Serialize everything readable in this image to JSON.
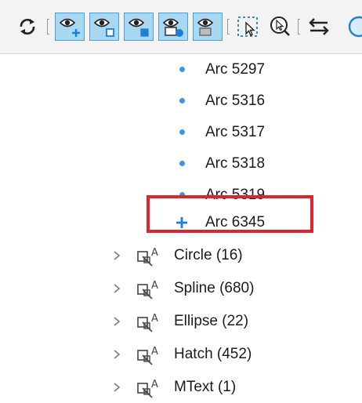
{
  "toolbar": {
    "buttons": [
      {
        "name": "refresh-icon"
      },
      {
        "name": "eye-plus-icon"
      },
      {
        "name": "eye-square-icon"
      },
      {
        "name": "eye-filled-square-icon"
      },
      {
        "name": "eye-target-icon"
      },
      {
        "name": "eye-gray-icon"
      },
      {
        "name": "select-cursor-icon"
      },
      {
        "name": "zoom-cursor-icon"
      },
      {
        "name": "swap-arrows-icon"
      },
      {
        "name": "circle-partial-icon"
      }
    ]
  },
  "tree": {
    "arcs": [
      {
        "label": "Arc 5297",
        "icon": "dot"
      },
      {
        "label": "Arc 5316",
        "icon": "dot"
      },
      {
        "label": "Arc 5317",
        "icon": "dot"
      },
      {
        "label": "Arc 5318",
        "icon": "dot"
      },
      {
        "label": "Arc 5319",
        "icon": "dot"
      },
      {
        "label": "Arc 6345",
        "icon": "plus"
      }
    ],
    "groups": [
      {
        "label": "Circle (16)"
      },
      {
        "label": "Spline (680)"
      },
      {
        "label": "Ellipse (22)"
      },
      {
        "label": "Hatch (452)"
      },
      {
        "label": "MText (1)"
      }
    ]
  },
  "colors": {
    "highlight": "#e0242b",
    "dot": "#3b96e4",
    "active_button": "#a8d8f2"
  }
}
